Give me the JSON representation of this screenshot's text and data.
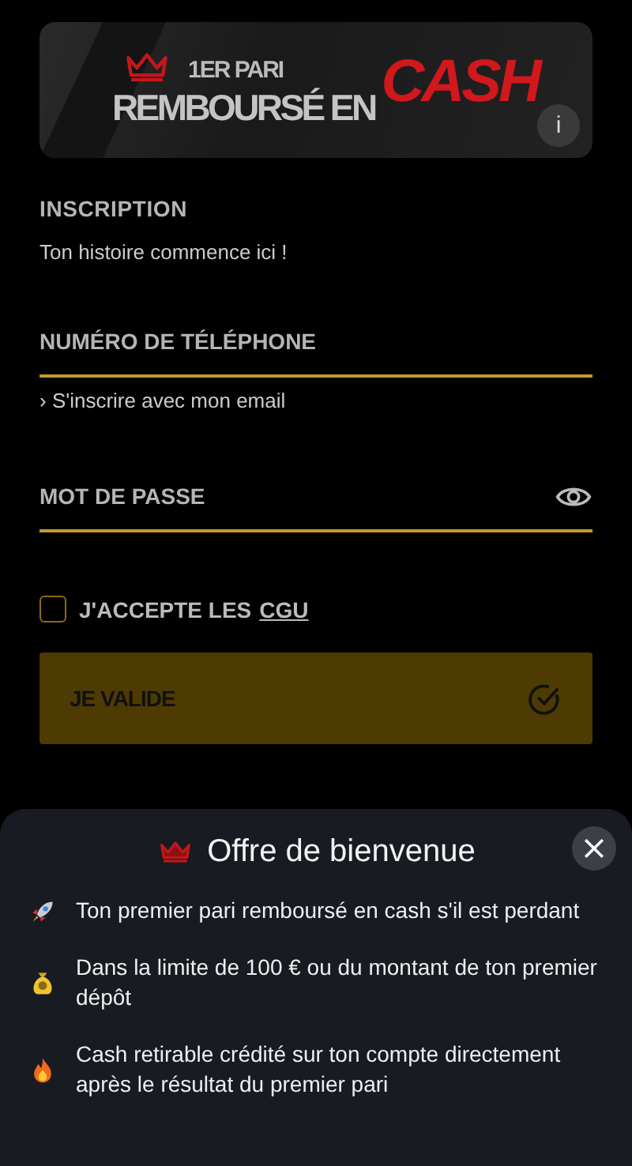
{
  "banner": {
    "line_1": "1ER PARI",
    "line_2": "REMBOURSÉ EN",
    "line_3": "CASH",
    "info": "i"
  },
  "heading": {
    "title": "INSCRIPTION",
    "subtitle": "Ton histoire commence ici !"
  },
  "phone_field": {
    "placeholder": "NUMÉRO DE TÉLÉPHONE"
  },
  "email_link": {
    "arrow": "›",
    "label": "S'inscrire avec mon email"
  },
  "password_field": {
    "placeholder": "MOT DE PASSE"
  },
  "terms": {
    "checked": false,
    "label": "J'ACCEPTE LES",
    "link": "CGU"
  },
  "submit_button": {
    "label": "JE VALIDE"
  },
  "offer_sheet": {
    "title": "Offre de bienvenue",
    "items": [
      {
        "text": "Ton premier pari remboursé en cash s'il est perdant"
      },
      {
        "text": "Dans la limite de 100 € ou du montant de ton premier dépôt"
      },
      {
        "text": "Cash retirable crédité sur ton compte directement après le résultat du premier pari"
      }
    ]
  }
}
